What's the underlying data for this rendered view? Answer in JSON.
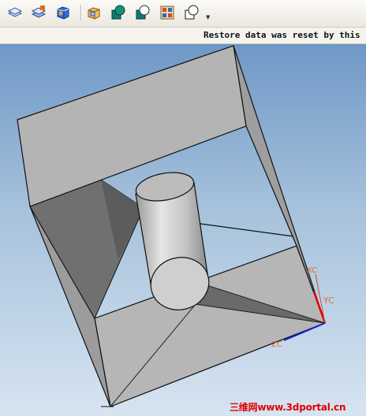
{
  "toolbar": {
    "icons": [
      "view-layers-icon",
      "layer-stack-icon",
      "shaded-box-icon",
      "wireframe-box-icon",
      "unite-body-icon",
      "subtract-body-icon",
      "intersect-body-icon",
      "display-options-icon"
    ],
    "dropdown_icon": "dropdown-arrow-icon"
  },
  "status": {
    "message": "Restore data was reset by this"
  },
  "triad": {
    "xc": "XC",
    "yc": "YC",
    "zc": "ZC"
  },
  "watermark": "三维网www.3dportal.cn",
  "colors": {
    "background_top": "#6e98c6",
    "background_bottom": "#d6e4f0",
    "model_face": "#b4b4b4",
    "model_dark": "#6e6e6e",
    "axis_y": "#e00000",
    "axis_z": "#1020d0",
    "axis_label": "#e07030",
    "watermark": "#e00000"
  }
}
